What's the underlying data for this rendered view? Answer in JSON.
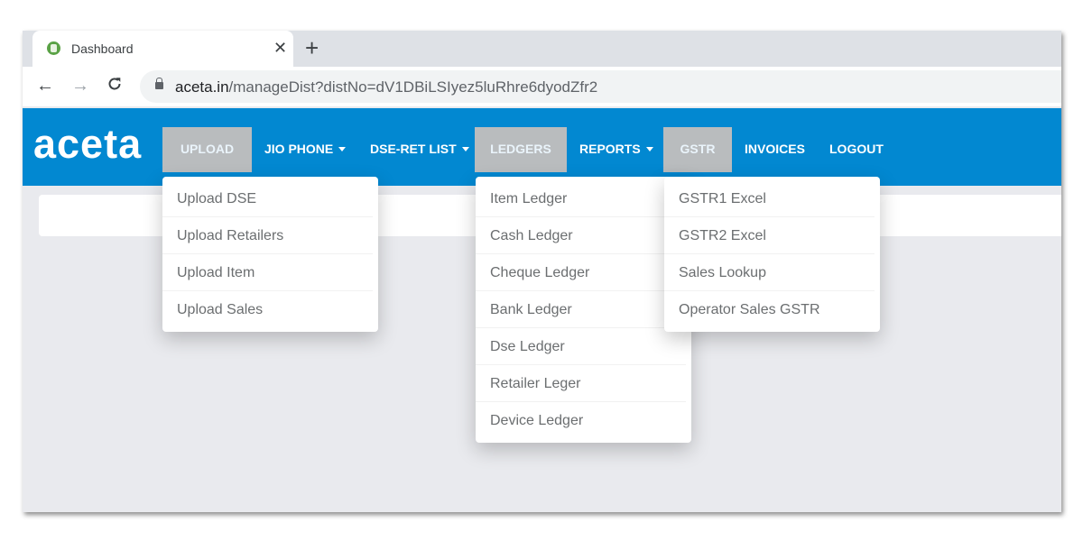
{
  "browser": {
    "tab_title": "Dashboard",
    "tab_close": "✕",
    "new_tab": "+",
    "url_host": "aceta.in",
    "url_path": "/manageDist?distNo=dV1DBiLSIyez5luRhre6dyodZfr2",
    "back": "←",
    "forward": "→",
    "reload": "C"
  },
  "navbar": {
    "brand": "aceta",
    "items": [
      {
        "label": "UPLOAD",
        "active": true
      },
      {
        "label": "JIO PHONE",
        "caret": true
      },
      {
        "label": "DSE-RET LIST",
        "caret": true
      },
      {
        "label": "LEDGERS",
        "active": true
      },
      {
        "label": "REPORTS",
        "caret": true
      },
      {
        "label": "GSTR",
        "active": true
      },
      {
        "label": "INVOICES"
      },
      {
        "label": "LOGOUT"
      }
    ]
  },
  "menus": {
    "upload": [
      "Upload DSE",
      "Upload Retailers",
      "Upload Item",
      "Upload Sales"
    ],
    "ledgers": [
      "Item Ledger",
      "Cash Ledger",
      "Cheque Ledger",
      "Bank Ledger",
      "Dse Ledger",
      "Retailer Leger",
      "Device Ledger"
    ],
    "gstr": [
      "GSTR1 Excel",
      "GSTR2 Excel",
      "Sales Lookup",
      "Operator Sales GSTR"
    ]
  },
  "colors": {
    "navbar": "#0288d1",
    "active_tab": "#b9bcbe",
    "page_bg": "#e9eaee"
  }
}
